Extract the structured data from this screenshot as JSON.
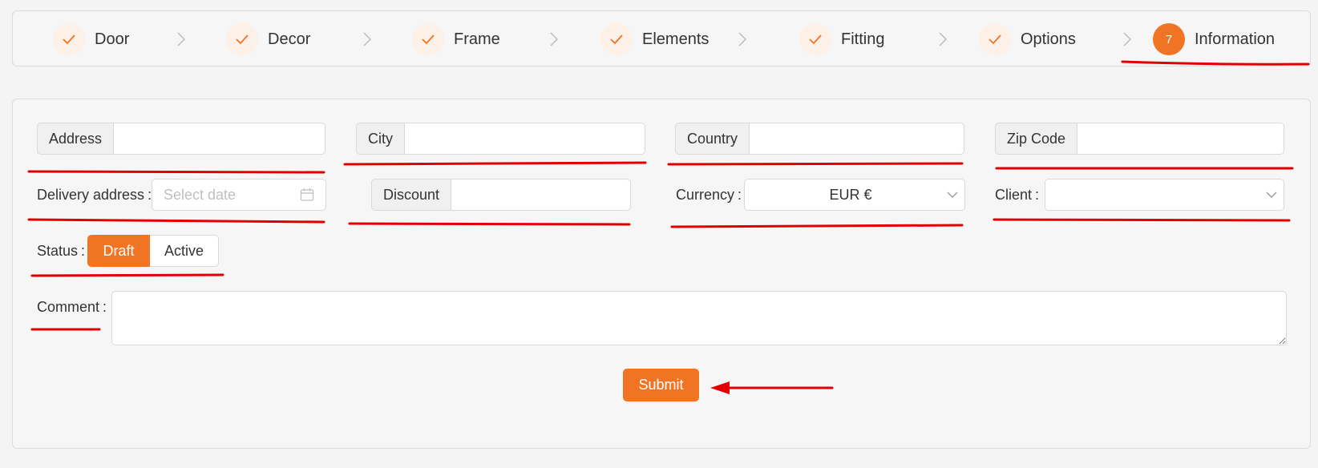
{
  "stepper": {
    "steps": [
      {
        "label": "Door",
        "status": "done",
        "icon": "check-icon"
      },
      {
        "label": "Decor",
        "status": "done",
        "icon": "check-icon"
      },
      {
        "label": "Frame",
        "status": "done",
        "icon": "check-icon"
      },
      {
        "label": "Elements",
        "status": "done",
        "icon": "check-icon"
      },
      {
        "label": "Fitting",
        "status": "done",
        "icon": "check-icon"
      },
      {
        "label": "Options",
        "status": "done",
        "icon": "check-icon"
      },
      {
        "label": "Information",
        "status": "active",
        "number": "7"
      }
    ],
    "separator_icon": "chevron-right-icon"
  },
  "form": {
    "address": {
      "label": "Address",
      "value": ""
    },
    "city": {
      "label": "City",
      "value": ""
    },
    "country": {
      "label": "Country",
      "value": ""
    },
    "zip_code": {
      "label": "Zip Code",
      "value": ""
    },
    "delivery_address": {
      "label": "Delivery address",
      "placeholder": "Select date",
      "icon": "calendar-icon"
    },
    "discount": {
      "label": "Discount",
      "value": ""
    },
    "currency": {
      "label": "Currency",
      "value": "EUR €",
      "icon": "chevron-down-icon"
    },
    "client": {
      "label": "Client",
      "value": "",
      "icon": "chevron-down-icon"
    },
    "status": {
      "label": "Status",
      "options": [
        "Draft",
        "Active"
      ],
      "selected": "Draft"
    },
    "comment": {
      "label": "Comment",
      "value": ""
    },
    "colon": ":",
    "submit_label": "Submit"
  },
  "theme": {
    "accent": "#f07423",
    "annotation": "#e00000"
  }
}
